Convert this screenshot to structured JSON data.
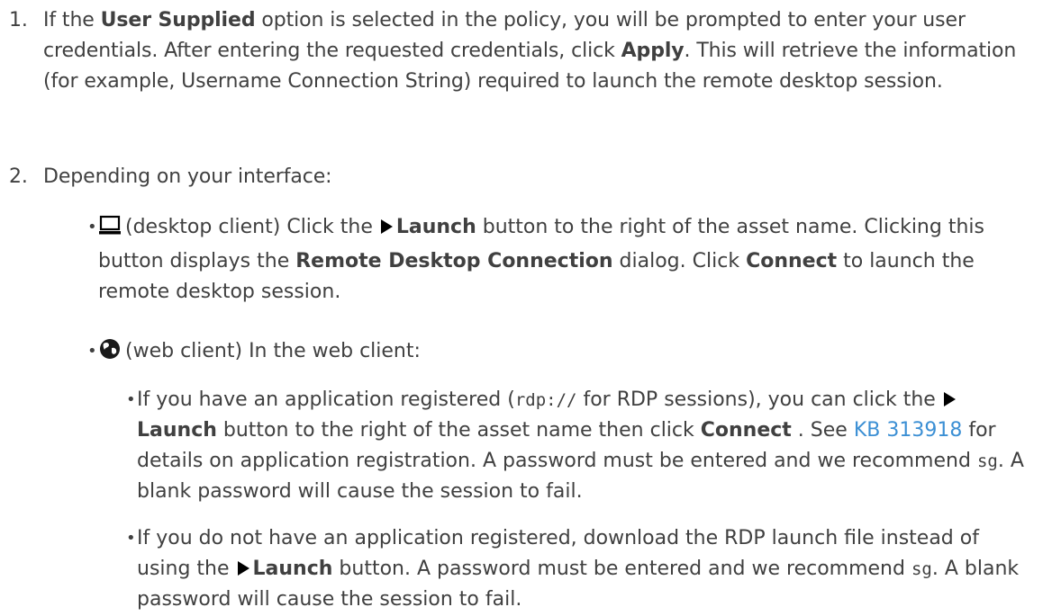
{
  "steps": [
    {
      "number": "1.",
      "t1": "If the ",
      "b1": "User Supplied",
      "t2": " option is selected in the policy, you will be prompted to enter your user credentials. After entering the requested credentials, click ",
      "b2": "Apply",
      "t3": ". This will retrieve the information (for example, Username Connection String) required to launch the remote desktop session."
    },
    {
      "number": "2.",
      "text": "Depending on your interface:"
    }
  ],
  "desktop_client": {
    "icon": "desktop-monitor-icon",
    "t1": "(desktop client) Click the ",
    "b1": "Launch",
    "t2": " button to the right of the asset name. Clicking this button displays the ",
    "b2": "Remote Desktop Connection",
    "t3": " dialog. Click ",
    "b3": "Connect",
    "t4": " to launch the remote desktop session."
  },
  "web_client": {
    "icon": "globe-icon",
    "text": "(web client) In the web client:",
    "bullets": [
      {
        "t1": "If you have an application registered (",
        "code1": "rdp://",
        "t2": " for RDP sessions), you can click the ",
        "b1": "Launch",
        "t3": " button to the right of the asset name then click ",
        "b2": "Connect",
        "t4": " . See ",
        "link": "KB 313918",
        "t5": " for details on application registration. A password must be entered and we recommend ",
        "code2": "sg",
        "t6": ". A blank password will cause the session to fail."
      },
      {
        "t1": "If you do not have an application registered, download the RDP launch file instead of using the ",
        "b1": "Launch",
        "t2": " button. A password must be entered and we recommend ",
        "code1": "sg",
        "t3": ". A blank password will cause the session to fail."
      }
    ]
  }
}
